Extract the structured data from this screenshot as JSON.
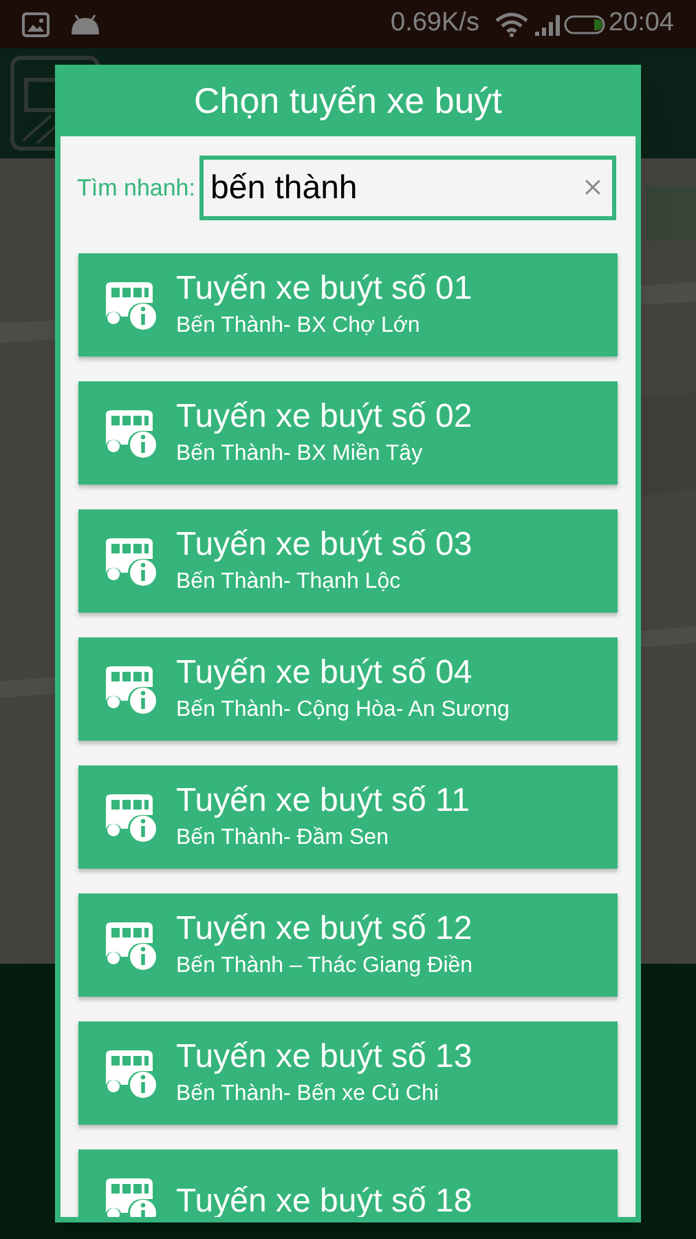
{
  "status_bar": {
    "network_speed": "0.69K/s",
    "time": "20:04"
  },
  "dialog": {
    "title": "Chọn tuyến xe buýt",
    "search": {
      "label": "Tìm nhanh:",
      "value": "bến thành"
    },
    "routes": [
      {
        "name": "Tuyến xe buýt số 01",
        "stops": "Bến Thành- BX Chợ Lớn"
      },
      {
        "name": "Tuyến xe buýt số 02",
        "stops": "Bến Thành- BX Miền Tây"
      },
      {
        "name": "Tuyến xe buýt số 03",
        "stops": "Bến Thành- Thạnh Lộc"
      },
      {
        "name": "Tuyến xe buýt số 04",
        "stops": "Bến Thành- Cộng Hòa- An Sương"
      },
      {
        "name": "Tuyến xe buýt số 11",
        "stops": "Bến Thành- Đầm Sen"
      },
      {
        "name": "Tuyến xe buýt số 12",
        "stops": "Bến Thành – Thác Giang Điền"
      },
      {
        "name": "Tuyến xe buýt số 13",
        "stops": "Bến Thành- Bến xe Củ Chi"
      },
      {
        "name": "Tuyến xe buýt số 18"
      }
    ]
  }
}
